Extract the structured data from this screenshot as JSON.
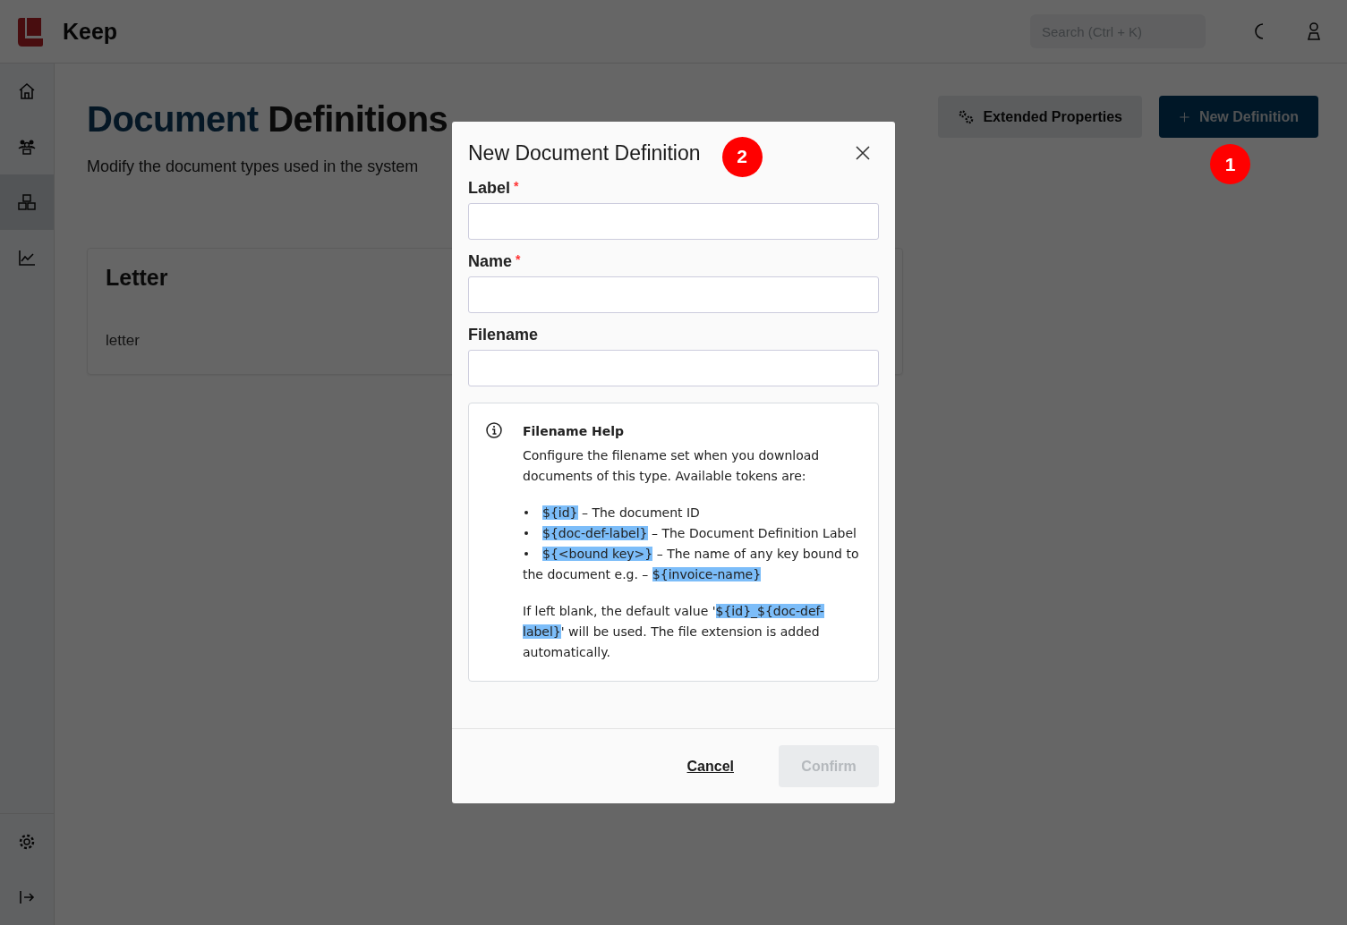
{
  "app": {
    "name": "Keep"
  },
  "search": {
    "placeholder": "Search (Ctrl + K)"
  },
  "sidebar": {
    "items": [
      {
        "kind": "home",
        "selected": false
      },
      {
        "kind": "users",
        "selected": false
      },
      {
        "kind": "boxes",
        "selected": true
      },
      {
        "kind": "chart",
        "selected": false
      }
    ],
    "bottom_items": [
      {
        "kind": "settings"
      },
      {
        "kind": "expand"
      }
    ]
  },
  "page": {
    "title_first": "Document",
    "title_rest": "Definitions",
    "subtitle": "Modify the document types used in the system",
    "actions": [
      {
        "kind": "secondary",
        "label": "Extended Properties"
      },
      {
        "kind": "primary",
        "label": "New Definition",
        "callout": "1"
      }
    ],
    "cards": [
      {
        "title": "Letter",
        "name": "letter"
      }
    ]
  },
  "dialog": {
    "title": "New Document Definition",
    "callout": "2",
    "fields": [
      {
        "label": "Label",
        "required_mark": "*"
      },
      {
        "label": "Name",
        "required_mark": "*"
      },
      {
        "label": "Filename"
      }
    ],
    "help": {
      "title": "Filename Help",
      "intro": "Configure the filename set when you download documents of this type. Available tokens are:",
      "items": [
        [
          {
            "text": "${id}",
            "highlighted": true
          },
          {
            "text": " – The document ID",
            "highlighted": false
          }
        ],
        [
          {
            "text": "${doc-def-label}",
            "highlighted": true
          },
          {
            "text": " – The Document Definition Label",
            "highlighted": false
          }
        ],
        [
          {
            "text": "${<bound key>}",
            "highlighted": true
          },
          {
            "text": " – The name of any key bound to the document e.g. – ",
            "highlighted": false
          },
          {
            "text": "${invoice-name}",
            "highlighted": true
          }
        ]
      ],
      "note": [
        {
          "text": "If left blank, the default value '",
          "highlighted": false
        },
        {
          "text": "${id}_${doc-def-label}",
          "highlighted": true
        },
        {
          "text": "' will be used. The file extension is added automatically.",
          "highlighted": false
        }
      ]
    },
    "buttons": [
      {
        "kind": "link",
        "label": "Cancel",
        "disabled": false
      },
      {
        "kind": "primary",
        "label": "Confirm",
        "disabled": true
      }
    ]
  }
}
